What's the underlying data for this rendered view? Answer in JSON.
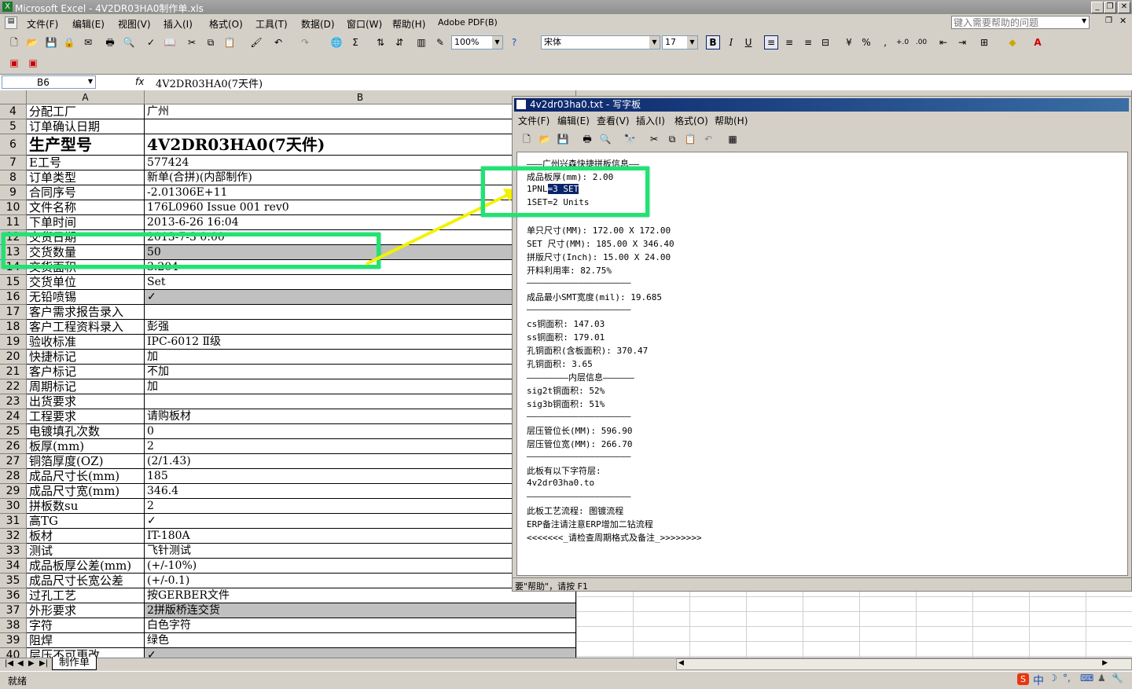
{
  "app": {
    "title": "Microsoft Excel - 4V2DR03HA0制作单.xls",
    "help_placeholder": "键入需要帮助的问题",
    "menus": [
      "文件(F)",
      "编辑(E)",
      "视图(V)",
      "插入(I)",
      "格式(O)",
      "工具(T)",
      "数据(D)",
      "窗口(W)",
      "帮助(H)",
      "Adobe PDF(B)"
    ],
    "zoom": "100%",
    "font_name": "宋体",
    "font_size": "17"
  },
  "formula": {
    "cell_ref": "B6",
    "fx": "fx",
    "value": "4V2DR03HA0(7天件)"
  },
  "columns": [
    "A",
    "B"
  ],
  "rows": [
    {
      "n": "4",
      "a": "分配工厂",
      "b": "广州"
    },
    {
      "n": "5",
      "a": "订单确认日期",
      "b": ""
    },
    {
      "n": "6",
      "a": "生产型号",
      "b": "4V2DR03HA0(7天件)"
    },
    {
      "n": "7",
      "a": "E工号",
      "b": "577424"
    },
    {
      "n": "8",
      "a": "订单类型",
      "b": "新单(合拼)(内部制作)"
    },
    {
      "n": "9",
      "a": "合同序号",
      "b": "-2.01306E+11"
    },
    {
      "n": "10",
      "a": "文件名称",
      "b": "176L0960 Issue 001 rev0"
    },
    {
      "n": "11",
      "a": "下单时间",
      "b": "2013-6-26 16:04"
    },
    {
      "n": "12",
      "a": "交货日期",
      "b": "2013-7-3 0:00"
    },
    {
      "n": "13",
      "a": "交货数量",
      "b": "50"
    },
    {
      "n": "14",
      "a": "交货面积",
      "b": "3.204"
    },
    {
      "n": "15",
      "a": "交货单位",
      "b": "Set"
    },
    {
      "n": "16",
      "a": "无铅喷锡",
      "b": "✓"
    },
    {
      "n": "17",
      "a": "客户需求报告录入",
      "b": ""
    },
    {
      "n": "18",
      "a": "客户工程资料录入",
      "b": "彭强"
    },
    {
      "n": "19",
      "a": "验收标准",
      "b": "IPC-6012 Ⅱ级"
    },
    {
      "n": "20",
      "a": "快捷标记",
      "b": "加"
    },
    {
      "n": "21",
      "a": "客户标记",
      "b": "不加"
    },
    {
      "n": "22",
      "a": "周期标记",
      "b": "加"
    },
    {
      "n": "23",
      "a": "出货要求",
      "b": ""
    },
    {
      "n": "24",
      "a": "工程要求",
      "b": "请购板材"
    },
    {
      "n": "25",
      "a": "电镀填孔次数",
      "b": "0"
    },
    {
      "n": "26",
      "a": "板厚(mm)",
      "b": "2"
    },
    {
      "n": "27",
      "a": "铜箔厚度(OZ)",
      "b": "(2/1.43)"
    },
    {
      "n": "28",
      "a": "成品尺寸长(mm)",
      "b": "185"
    },
    {
      "n": "29",
      "a": "成品尺寸宽(mm)",
      "b": "346.4"
    },
    {
      "n": "30",
      "a": "拼板数su",
      "b": "2"
    },
    {
      "n": "31",
      "a": "高TG",
      "b": "✓"
    },
    {
      "n": "32",
      "a": "板材",
      "b": "IT-180A"
    },
    {
      "n": "33",
      "a": "测试",
      "b": "飞针测试"
    },
    {
      "n": "34",
      "a": "成品板厚公差(mm)",
      "b": "(+/-10%)"
    },
    {
      "n": "35",
      "a": "成品尺寸长宽公差",
      "b": "(+/-0.1)"
    },
    {
      "n": "36",
      "a": "过孔工艺",
      "b": "按GERBER文件"
    },
    {
      "n": "37",
      "a": "外形要求",
      "b": "2拼版桥连交货"
    },
    {
      "n": "38",
      "a": "字符",
      "b": "白色字符"
    },
    {
      "n": "39",
      "a": "阻焊",
      "b": "绿色"
    },
    {
      "n": "40",
      "a": "层压不可更改",
      "b": "✓"
    }
  ],
  "sheet_tab": "制作单",
  "status": "就绪",
  "wordpad": {
    "title": "4v2dr03ha0.txt - 写字板",
    "menus": [
      "文件(F)",
      "编辑(E)",
      "查看(V)",
      "插入(I)",
      "格式(O)",
      "帮助(H)"
    ],
    "status": "要\"帮助\"，请按 F1",
    "line0": "———广州兴森快捷拼板信息——",
    "line1": "成品板厚(mm): 2.00",
    "line2a": "1PNL",
    "line2b": "=3 SET",
    "lines_rest": [
      "1SET=2 Units",
      "————————————————————",
      "单只尺寸(MM): 172.00 X 172.00",
      "SET 尺寸(MM): 185.00 X 346.40",
      "拼版尺寸(Inch): 15.00 X 24.00",
      "开料利用率: 82.75%",
      "————————————————————",
      "成品最小SMT宽度(mil): 19.685",
      "————————————————————",
      "cs铜面积: 147.03",
      "ss铜面积: 179.01",
      "孔铜面积(含板面积): 370.47",
      "孔铜面积: 3.65",
      "————————内层信息——————",
      "sig2t铜面积: 52%",
      "sig3b铜面积: 51%",
      "————————————————————",
      "层压管位长(MM): 596.90",
      "层压管位宽(MM): 266.70",
      "————————————————————",
      "此板有以下字符层:",
      "4v2dr03ha0.to",
      "————————————————————",
      "此板工艺流程: 图镀流程",
      "ERP备注请注意ERP增加二钻流程",
      "<<<<<<<_请检查周期格式及备注_>>>>>>>>"
    ]
  },
  "tray": {
    "ime": "中",
    "s_logo": "S"
  },
  "colors": {
    "highlight_box": "#22e36f",
    "arrow": "#f2f200"
  }
}
